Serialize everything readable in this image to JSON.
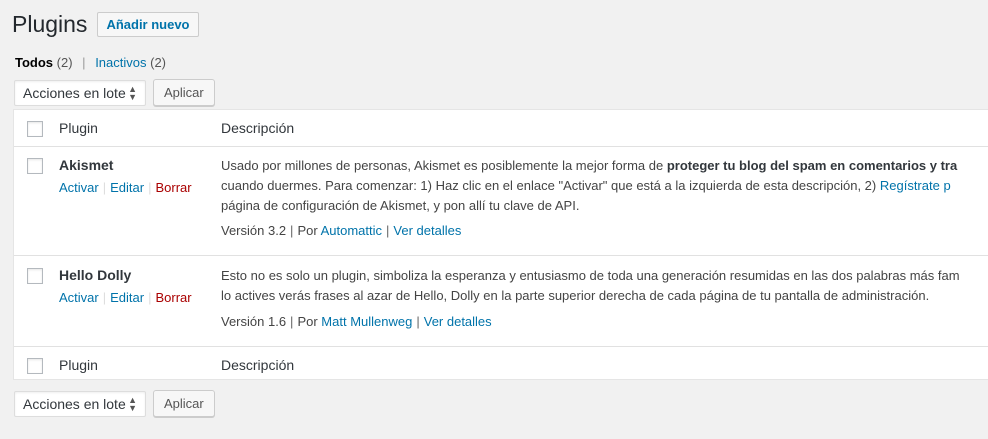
{
  "header": {
    "title": "Plugins",
    "add_new": "Añadir nuevo"
  },
  "filters": {
    "all_label": "Todos",
    "all_count": "(2)",
    "separator": "|",
    "inactive_label": "Inactivos",
    "inactive_count": "(2)"
  },
  "bulk": {
    "select_value": "Acciones en lote",
    "apply": "Aplicar"
  },
  "table": {
    "col_plugin": "Plugin",
    "col_description": "Descripción",
    "action_sep": "|",
    "meta_sep": "|",
    "rows": [
      {
        "name": "Akismet",
        "activate": "Activar",
        "edit": "Editar",
        "delete": "Borrar",
        "desc_l1_a": "Usado por millones de personas, Akismet es posiblemente la mejor forma de ",
        "desc_l1_bold": "proteger tu blog del spam en comentarios y tra",
        "desc_l2_a": "cuando duermes. Para comenzar: 1) Haz clic en el enlace \"Activar\" que está a la izquierda de esta descripción, 2) ",
        "desc_l2_link": "Regístrate p",
        "desc_l3": "página de configuración de Akismet, y pon allí tu clave de API.",
        "version": "Versión 3.2",
        "by": "Por",
        "author": "Automattic",
        "details": "Ver detalles"
      },
      {
        "name": "Hello Dolly",
        "activate": "Activar",
        "edit": "Editar",
        "delete": "Borrar",
        "desc_l1": "Esto no es solo un plugin, simboliza la esperanza y entusiasmo de toda una generación resumidas en las dos palabras más fam",
        "desc_l2": "lo actives verás frases al azar de Hello, Dolly en la parte superior derecha de cada página de tu pantalla de administración.",
        "version": "Versión 1.6",
        "by": "Por",
        "author": "Matt Mullenweg",
        "details": "Ver detalles"
      }
    ]
  }
}
